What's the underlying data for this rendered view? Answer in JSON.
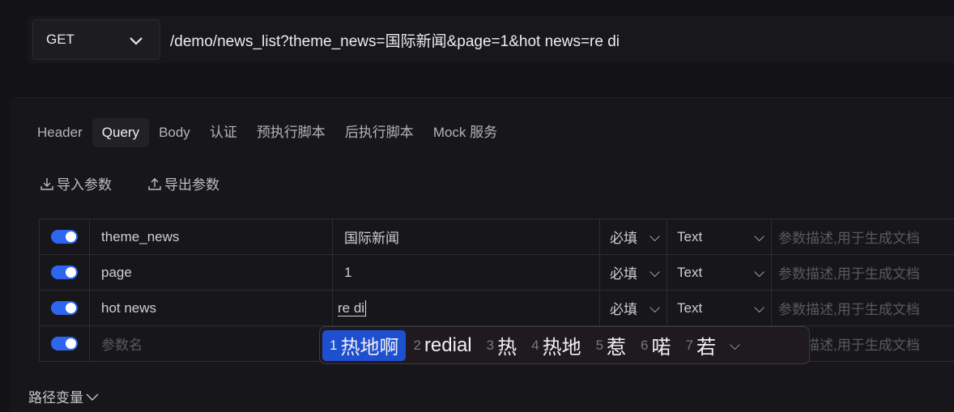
{
  "request": {
    "method": "GET",
    "url": "/demo/news_list?theme_news=国际新闻&page=1&hot news=re di"
  },
  "tabs": [
    {
      "label": "Header"
    },
    {
      "label": "Query",
      "active": true
    },
    {
      "label": "Body"
    },
    {
      "label": "认证"
    },
    {
      "label": "预执行脚本"
    },
    {
      "label": "后执行脚本"
    },
    {
      "label": "Mock 服务"
    }
  ],
  "actions": {
    "import": "导入参数",
    "export": "导出参数"
  },
  "params": [
    {
      "enabled": true,
      "name": "theme_news",
      "value": "国际新闻",
      "required": "必填",
      "type": "Text",
      "desc_placeholder": "参数描述,用于生成文档"
    },
    {
      "enabled": true,
      "name": "page",
      "value": "1",
      "required": "必填",
      "type": "Text",
      "desc_placeholder": "参数描述,用于生成文档"
    },
    {
      "enabled": true,
      "name": "hot news",
      "value": "re di",
      "required": "必填",
      "type": "Text",
      "desc_placeholder": "参数描述,用于生成文档"
    },
    {
      "enabled": true,
      "name_placeholder": "参数名",
      "desc_placeholder": "参数描述,用于生成文档"
    }
  ],
  "ime": {
    "candidates": [
      {
        "n": "1",
        "t": "热地啊"
      },
      {
        "n": "2",
        "t": "redial"
      },
      {
        "n": "3",
        "t": "热"
      },
      {
        "n": "4",
        "t": "热地"
      },
      {
        "n": "5",
        "t": "惹"
      },
      {
        "n": "6",
        "t": "喏"
      },
      {
        "n": "7",
        "t": "若"
      }
    ],
    "highlight_color": "#1e4fd0"
  },
  "path_vars": {
    "label": "路径变量"
  },
  "colors": {
    "accent": "#2f66f0"
  }
}
